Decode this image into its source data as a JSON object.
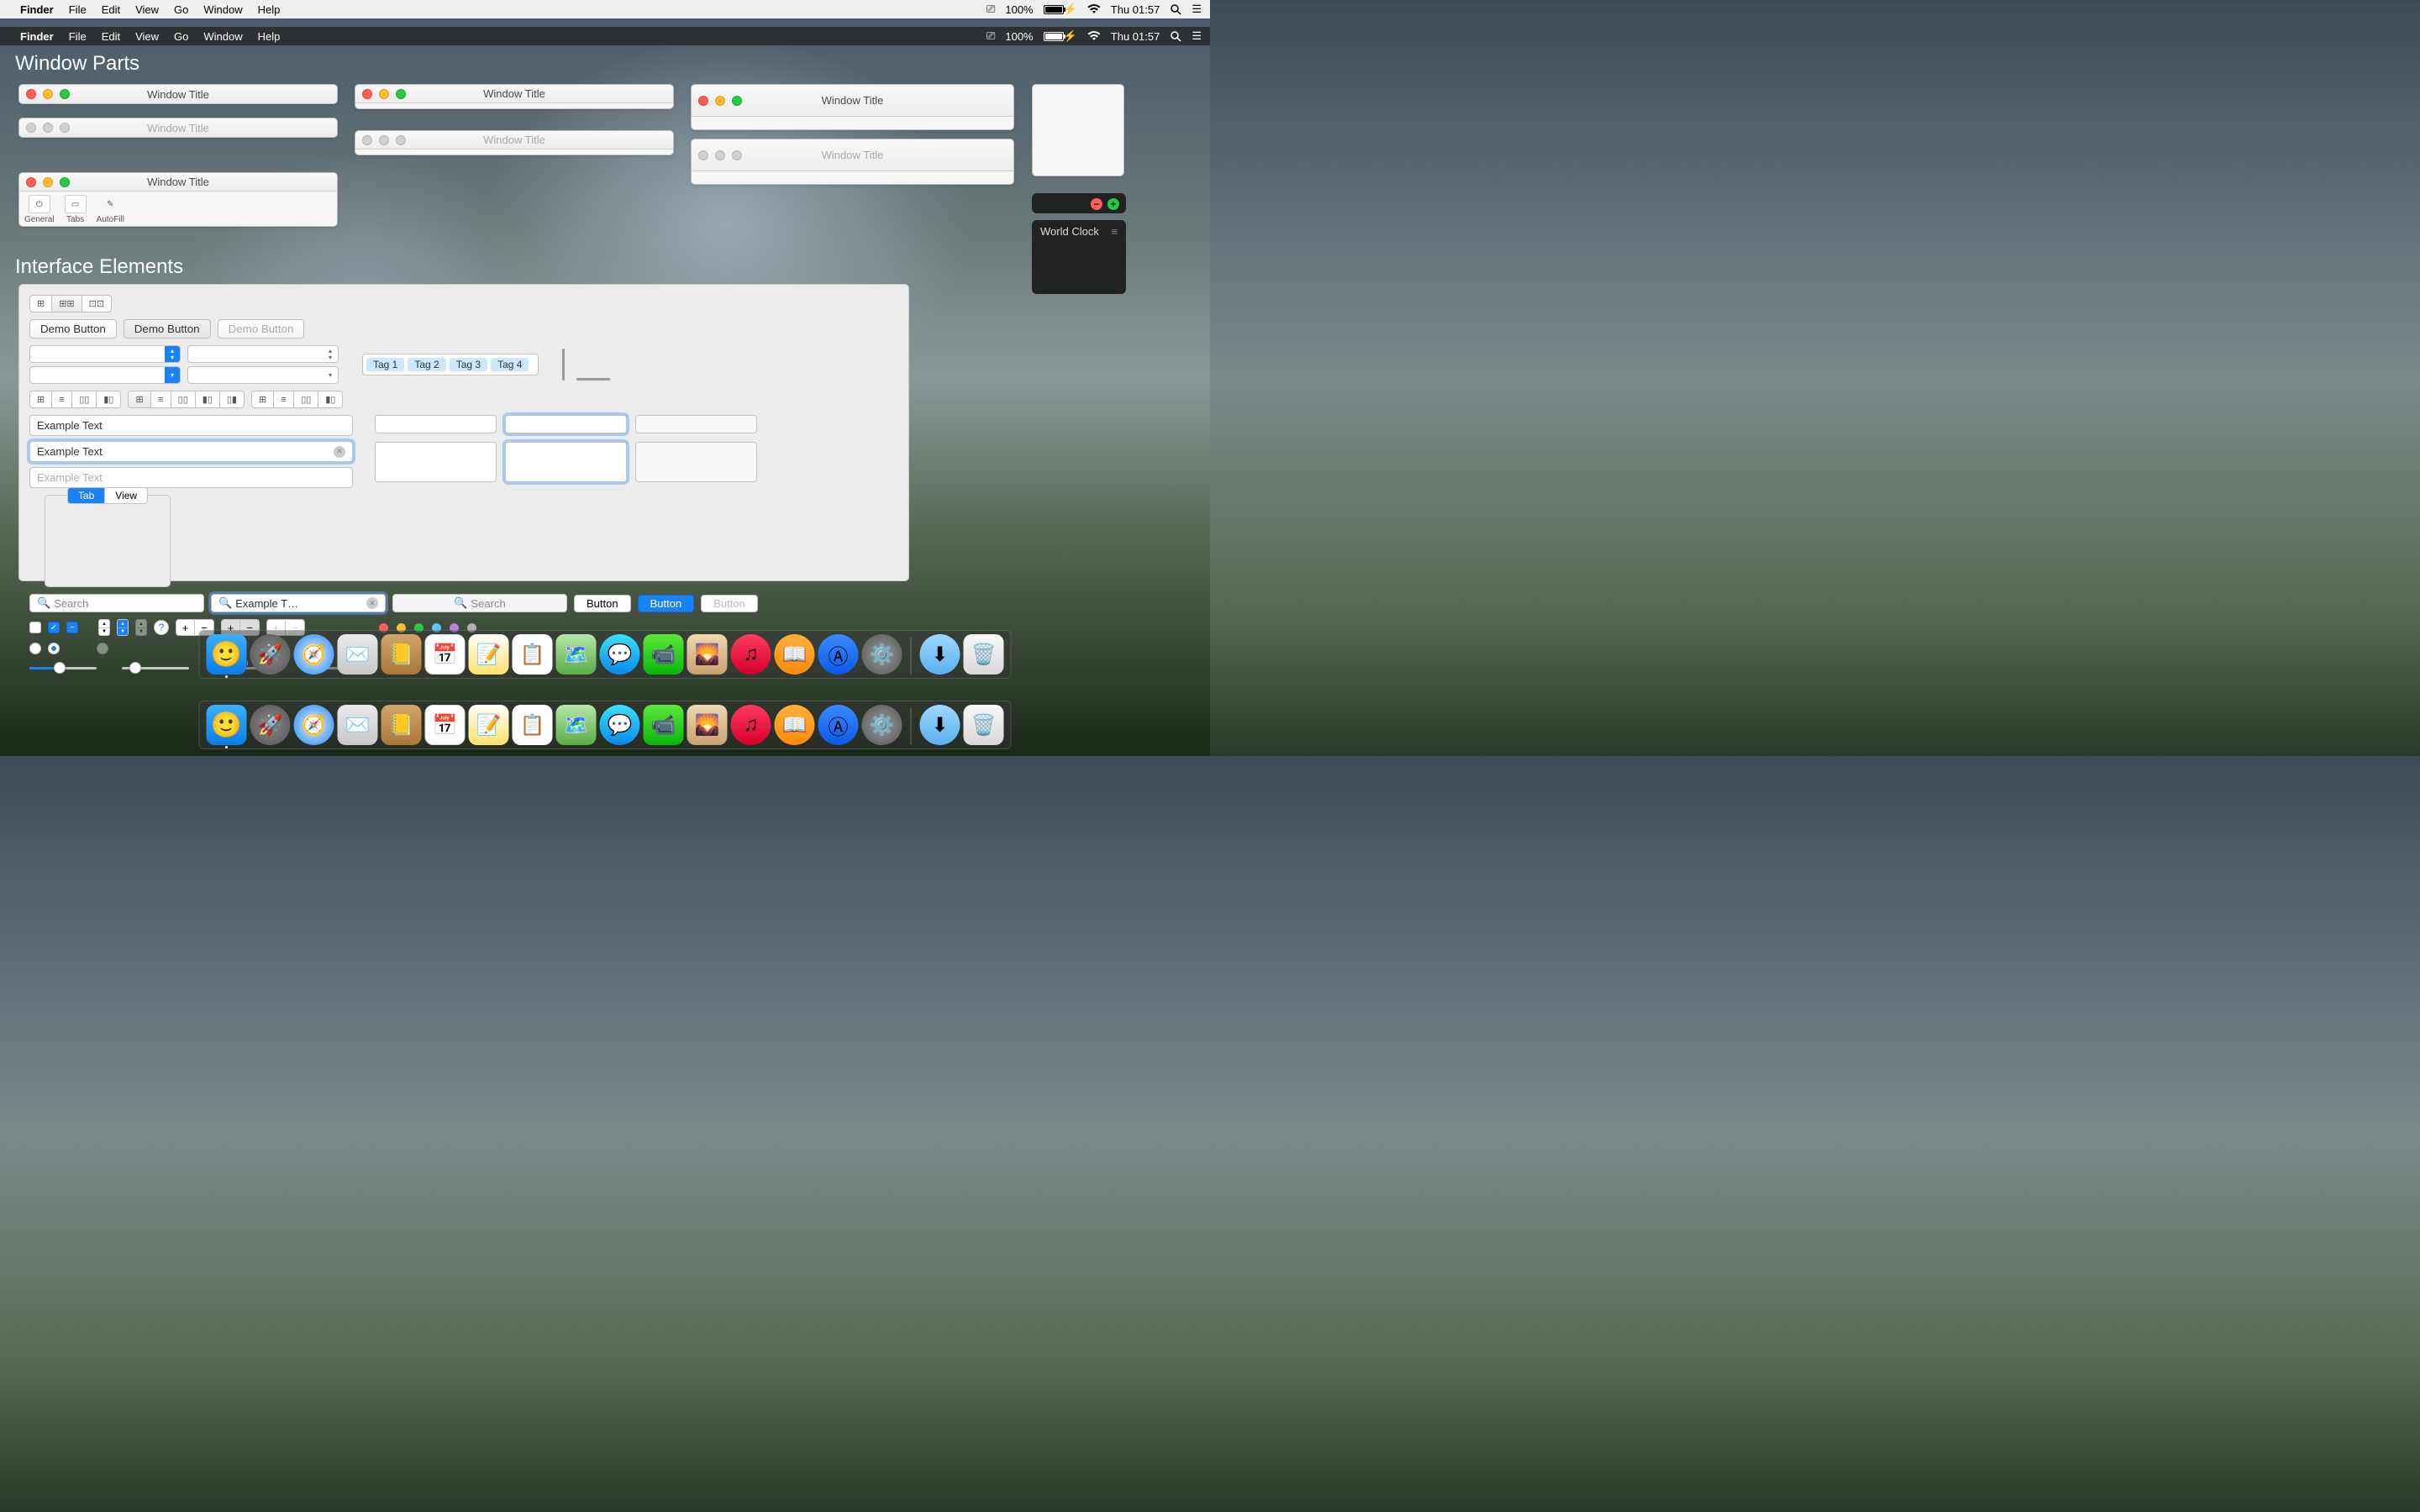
{
  "menubar": {
    "app": "Finder",
    "menus": [
      "File",
      "Edit",
      "View",
      "Go",
      "Window",
      "Help"
    ],
    "battery": "100%",
    "clock": "Thu 01:57"
  },
  "sections": {
    "window_parts": "Window Parts",
    "interface_elements": "Interface Elements"
  },
  "windows": {
    "title": "Window Title",
    "toolbar": {
      "general": "General",
      "tabs": "Tabs",
      "autofill": "AutoFill"
    }
  },
  "widget": {
    "world_clock": "World Clock"
  },
  "panel": {
    "demo_button": "Demo Button",
    "tags": [
      "Tag 1",
      "Tag 2",
      "Tag 3",
      "Tag 4"
    ],
    "example_text": "Example Text",
    "search": "Search",
    "search_focused": "Example T…",
    "button": "Button",
    "tab": "Tab",
    "view": "View",
    "colors": [
      "#ff5f57",
      "#ffbd2e",
      "#28ca42",
      "#5ac8fa",
      "#c080e0",
      "#b0b0b0"
    ]
  },
  "dock": {
    "apps": [
      "finder",
      "launchpad",
      "safari",
      "mail",
      "contacts",
      "calendar",
      "notes",
      "reminders",
      "maps",
      "messages",
      "facetime",
      "photos",
      "itunes",
      "ibooks",
      "appstore",
      "prefs"
    ],
    "running": [
      "finder"
    ]
  }
}
